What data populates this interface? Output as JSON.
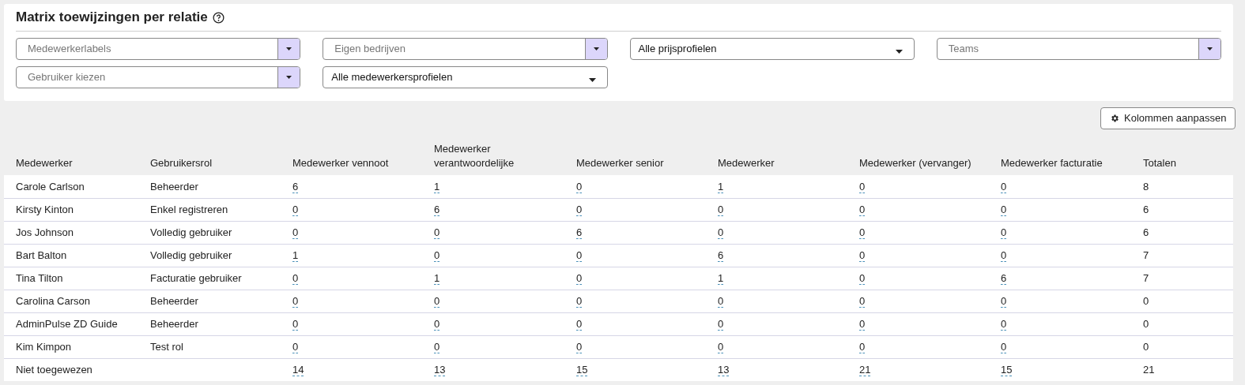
{
  "title": "Matrix toewijzingen per relatie",
  "filters": [
    {
      "kind": "multiselect",
      "placeholder": "Medewerkerlabels"
    },
    {
      "kind": "multiselect",
      "placeholder": "Eigen bedrijven"
    },
    {
      "kind": "select",
      "value": "Alle prijsprofielen"
    },
    {
      "kind": "multiselect",
      "placeholder": "Teams"
    },
    {
      "kind": "multiselect",
      "placeholder": "Gebruiker kiezen"
    },
    {
      "kind": "select",
      "value": "Alle medewerkersprofielen"
    }
  ],
  "columns_button": "Kolommen aanpassen",
  "table": {
    "columns": [
      "Medewerker",
      "Gebruikersrol",
      "Medewerker vennoot",
      "Medewerker verantwoordelijke",
      "Medewerker senior",
      "Medewerker",
      "Medewerker (vervanger)",
      "Medewerker facturatie",
      "Totalen"
    ],
    "rows": [
      {
        "name": "Carole Carlson",
        "role": "Beheerder",
        "counts": [
          "6",
          "1",
          "0",
          "1",
          "0",
          "0"
        ],
        "total": "8"
      },
      {
        "name": "Kirsty Kinton",
        "role": "Enkel registreren",
        "counts": [
          "0",
          "6",
          "0",
          "0",
          "0",
          "0"
        ],
        "total": "6"
      },
      {
        "name": "Jos Johnson",
        "role": "Volledig gebruiker",
        "counts": [
          "0",
          "0",
          "6",
          "0",
          "0",
          "0"
        ],
        "total": "6"
      },
      {
        "name": "Bart Balton",
        "role": "Volledig gebruiker",
        "counts": [
          "1",
          "0",
          "0",
          "6",
          "0",
          "0"
        ],
        "total": "7"
      },
      {
        "name": "Tina Tilton",
        "role": "Facturatie gebruiker",
        "counts": [
          "0",
          "1",
          "0",
          "1",
          "0",
          "6"
        ],
        "total": "7"
      },
      {
        "name": "Carolina Carson",
        "role": "Beheerder",
        "counts": [
          "0",
          "0",
          "0",
          "0",
          "0",
          "0"
        ],
        "total": "0"
      },
      {
        "name": "AdminPulse ZD Guide",
        "role": "Beheerder",
        "counts": [
          "0",
          "0",
          "0",
          "0",
          "0",
          "0"
        ],
        "total": "0"
      },
      {
        "name": "Kim Kimpon",
        "role": "Test rol",
        "counts": [
          "0",
          "0",
          "0",
          "0",
          "0",
          "0"
        ],
        "total": "0"
      },
      {
        "name": "Niet toegewezen",
        "counts": [
          "14",
          "13",
          "15",
          "13",
          "21",
          "15"
        ],
        "total": "21"
      }
    ]
  }
}
